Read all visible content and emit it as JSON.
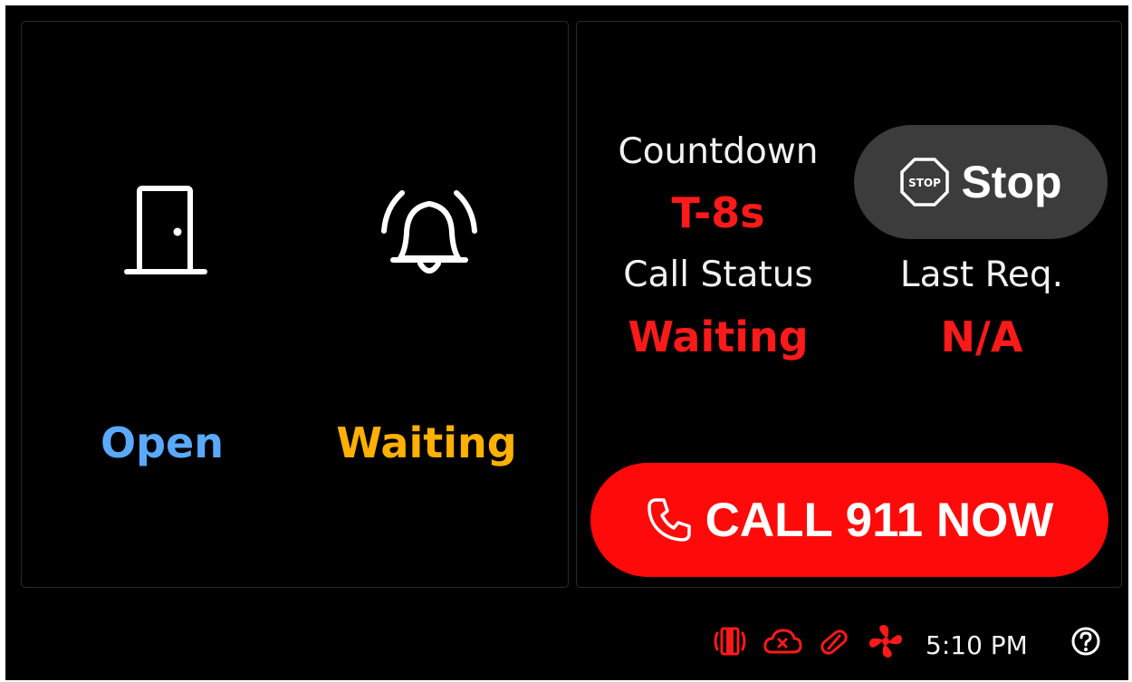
{
  "left_panel": {
    "door": {
      "icon": "door-icon",
      "status": "Open",
      "status_color": "#5aa9ff"
    },
    "alarm": {
      "icon": "bell-ringing-icon",
      "status": "Waiting",
      "status_color": "#ffb000"
    }
  },
  "right_panel": {
    "countdown": {
      "caption": "Countdown",
      "value": "T-8s"
    },
    "call_status": {
      "caption": "Call Status",
      "value": "Waiting"
    },
    "last_request": {
      "caption": "Last Req.",
      "value": "N/A"
    },
    "stop_button": {
      "icon": "stop-sign-icon",
      "icon_text": "STOP",
      "label": "Stop"
    },
    "call_button": {
      "icon": "phone-icon",
      "label": "CALL 911 NOW"
    },
    "value_color": "#ff1a1a",
    "call_button_color": "#ff0a0a"
  },
  "status_bar": {
    "icons": [
      "door-sensor-icon",
      "cloud-error-icon",
      "link-broken-icon",
      "fan-icon"
    ],
    "icon_color": "#ff1a1a",
    "time": "5:10 PM",
    "help_icon": "help-icon"
  }
}
